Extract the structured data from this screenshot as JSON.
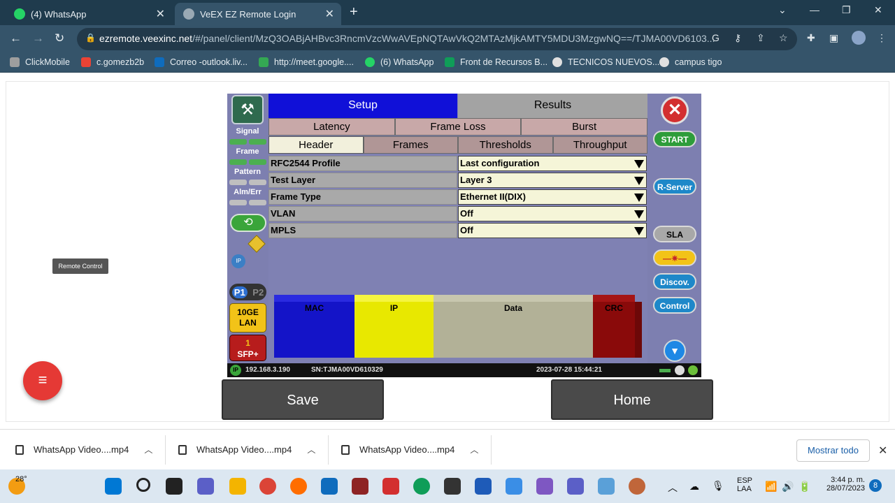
{
  "browser": {
    "tabs": [
      {
        "label": "(4) WhatsApp",
        "icon": "whatsapp-icon",
        "color": "#25d366"
      },
      {
        "label": "VeEX EZ Remote Login",
        "icon": "globe-icon",
        "color": "#9aa9b4"
      }
    ],
    "url_host": "ezremote.veexinc.net",
    "url_path": "/#/panel/client/MzQ3OABjAHBvc3RncmVzcWwAVEpNQTAwVkQ2MTAzMjkAMTY5MDU3MzgwNQ==/TJMA00VD6103...",
    "bookmarks": [
      {
        "label": "ClickMobile",
        "color": "#9e9e9e"
      },
      {
        "label": "c.gomezb2b",
        "color": "#ea4335"
      },
      {
        "label": "Correo -outlook.liv...",
        "color": "#0f6cbd"
      },
      {
        "label": "http://meet.google....",
        "color": "#34a853"
      },
      {
        "label": "(6) WhatsApp",
        "color": "#25d366"
      },
      {
        "label": "Front de Recursos B...",
        "color": "#0f9d58"
      },
      {
        "label": "TECNICOS NUEVOS...",
        "color": "#e0e0e0"
      },
      {
        "label": "campus tigo",
        "color": "#e0e0e0"
      }
    ]
  },
  "tooltip": "Remote Control",
  "device": {
    "main_tabs": {
      "setup": "Setup",
      "results": "Results"
    },
    "test_tabs": [
      "Latency",
      "Frame Loss",
      "Burst"
    ],
    "config_tabs": [
      "Header",
      "Frames",
      "Thresholds",
      "Throughput"
    ],
    "left": {
      "signal": "Signal",
      "frame": "Frame",
      "pattern": "Pattern",
      "alm": "Alm/Err",
      "p1": "P1",
      "p2": "P2",
      "lan_line1": "10GE",
      "lan_line2": "LAN",
      "sfp_num": "1",
      "sfp": "SFP+"
    },
    "right": {
      "start": "START",
      "rserver": "R-Server",
      "sla": "SLA",
      "discov": "Discov.",
      "control": "Control"
    },
    "fields": [
      {
        "name": "RFC2544 Profile",
        "value": "Last configuration"
      },
      {
        "name": "Test Layer",
        "value": "Layer 3"
      },
      {
        "name": "Frame Type",
        "value": "Ethernet II(DIX)"
      },
      {
        "name": "VLAN",
        "value": "Off"
      },
      {
        "name": "MPLS",
        "value": "Off"
      }
    ],
    "packet": {
      "mac": "MAC",
      "ip": "IP",
      "data": "Data",
      "crc": "CRC"
    },
    "status": {
      "ip": "192.168.3.190",
      "sn": "SN:TJMA00VD610329",
      "datetime": "2023-07-28  15:44:21"
    }
  },
  "buttons": {
    "save": "Save",
    "home": "Home"
  },
  "downloads": {
    "items": [
      "WhatsApp Video....mp4",
      "WhatsApp Video....mp4",
      "WhatsApp Video....mp4"
    ],
    "show_all": "Mostrar todo"
  },
  "taskbar": {
    "temp": "28°",
    "lang1": "ESP",
    "lang2": "LAA",
    "time": "3:44 p. m.",
    "date": "28/07/2023",
    "badge": "8"
  }
}
